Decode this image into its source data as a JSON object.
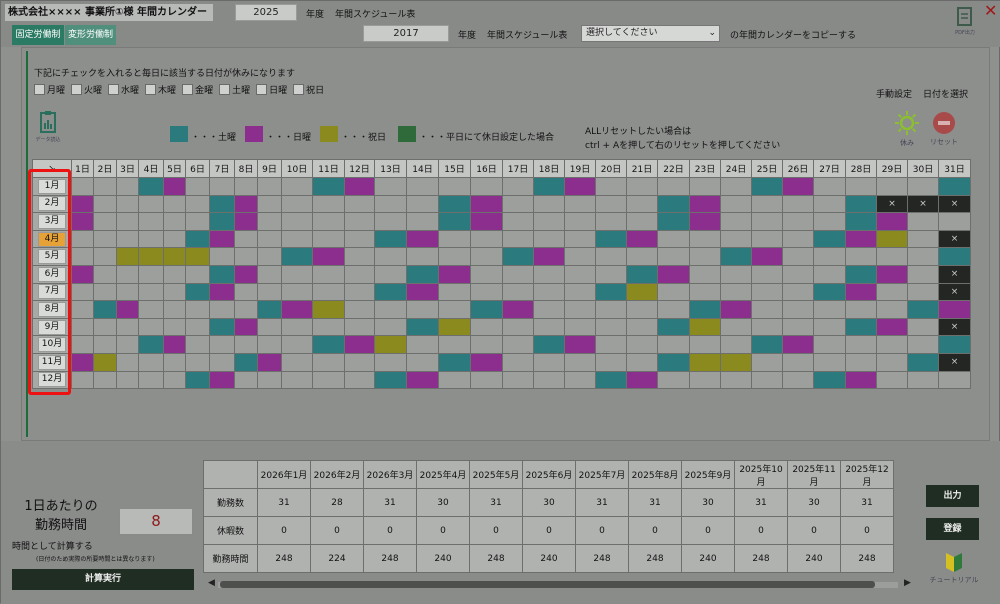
{
  "header": {
    "app_title": "株式会社××××  事業所①様 年間カレンダー",
    "year_top": "2025",
    "year_label": "年度",
    "schedule_label": "年間スケジュール表",
    "year_copy": "2017",
    "copy_select": "選択してください",
    "copy_suffix": "の年間カレンダーをコピーする",
    "tab_fixed": "固定労働制",
    "tab_variable": "変形労働制",
    "pdf_label": "PDF出力"
  },
  "checkbox_note": "下記にチェックを入れると毎日に該当する日付が休みになります",
  "weekdays": [
    "月曜",
    "火曜",
    "水曜",
    "木曜",
    "金曜",
    "土曜",
    "日曜",
    "祝日"
  ],
  "right_links": {
    "manual": "手動設定",
    "date_select": "日付を選択"
  },
  "legend": {
    "data_read": "データ読込",
    "sat": "・・・土曜",
    "sun": "・・・日曜",
    "holiday": "・・・祝日",
    "weekday_off": "・・・平日にて休日設定した場合",
    "colors": {
      "sat": "#2a7a7e",
      "sun": "#8b2e8d",
      "holiday": "#8a8a1e",
      "weekday_off": "#2f6b3a"
    }
  },
  "reset_note": {
    "line1": "ALLリセットしたい場合は",
    "line2": "ctrl + Aを押して右のリセットを押してください"
  },
  "icons": {
    "rest": "休み",
    "reset": "リセット"
  },
  "calendar": {
    "corner": "↘",
    "days": [
      "1日",
      "2日",
      "3日",
      "4日",
      "5日",
      "6日",
      "7日",
      "8日",
      "9日",
      "10日",
      "11日",
      "12日",
      "13日",
      "14日",
      "15日",
      "16日",
      "17日",
      "18日",
      "19日",
      "20日",
      "21日",
      "22日",
      "23日",
      "24日",
      "25日",
      "26日",
      "27日",
      "28日",
      "29日",
      "30日",
      "31日"
    ],
    "months": [
      "1月",
      "2月",
      "3月",
      "4月",
      "5月",
      "6月",
      "7月",
      "8月",
      "9月",
      "10月",
      "11月",
      "12月"
    ],
    "selected_month": 3,
    "rows": [
      [
        0,
        0,
        0,
        1,
        2,
        0,
        0,
        0,
        0,
        0,
        1,
        2,
        0,
        0,
        0,
        0,
        0,
        1,
        2,
        0,
        0,
        0,
        0,
        0,
        1,
        2,
        0,
        0,
        0,
        0,
        1
      ],
      [
        2,
        0,
        0,
        0,
        0,
        0,
        1,
        2,
        0,
        0,
        0,
        0,
        0,
        0,
        1,
        2,
        0,
        0,
        0,
        0,
        0,
        1,
        2,
        0,
        0,
        0,
        0,
        1,
        4,
        4,
        4
      ],
      [
        2,
        0,
        0,
        0,
        0,
        0,
        1,
        2,
        0,
        0,
        0,
        0,
        0,
        0,
        1,
        2,
        0,
        0,
        0,
        0,
        0,
        1,
        2,
        0,
        0,
        0,
        0,
        1,
        2,
        0,
        0
      ],
      [
        0,
        0,
        0,
        0,
        0,
        1,
        2,
        0,
        0,
        0,
        0,
        0,
        1,
        2,
        0,
        0,
        0,
        0,
        0,
        1,
        2,
        0,
        0,
        0,
        0,
        0,
        1,
        2,
        3,
        0,
        4
      ],
      [
        0,
        0,
        3,
        3,
        3,
        3,
        0,
        0,
        0,
        1,
        2,
        0,
        0,
        0,
        0,
        0,
        1,
        2,
        0,
        0,
        0,
        0,
        0,
        1,
        2,
        0,
        0,
        0,
        0,
        0,
        1
      ],
      [
        2,
        0,
        0,
        0,
        0,
        0,
        1,
        2,
        0,
        0,
        0,
        0,
        0,
        1,
        2,
        0,
        0,
        0,
        0,
        0,
        1,
        2,
        0,
        0,
        0,
        0,
        0,
        1,
        2,
        0,
        4
      ],
      [
        0,
        0,
        0,
        0,
        0,
        1,
        2,
        0,
        0,
        0,
        0,
        0,
        1,
        2,
        0,
        0,
        0,
        0,
        0,
        1,
        3,
        0,
        0,
        0,
        0,
        0,
        1,
        2,
        0,
        0,
        4
      ],
      [
        0,
        1,
        2,
        0,
        0,
        0,
        0,
        0,
        1,
        2,
        3,
        0,
        0,
        0,
        0,
        1,
        2,
        0,
        0,
        0,
        0,
        0,
        1,
        2,
        0,
        0,
        0,
        0,
        0,
        1,
        2
      ],
      [
        0,
        0,
        0,
        0,
        0,
        0,
        1,
        2,
        0,
        0,
        0,
        0,
        0,
        1,
        3,
        0,
        0,
        0,
        0,
        0,
        0,
        1,
        3,
        0,
        0,
        0,
        0,
        1,
        2,
        0,
        4
      ],
      [
        0,
        0,
        0,
        1,
        2,
        0,
        0,
        0,
        0,
        0,
        1,
        2,
        3,
        0,
        0,
        0,
        0,
        1,
        2,
        0,
        0,
        0,
        0,
        0,
        1,
        2,
        0,
        0,
        0,
        0,
        1
      ],
      [
        2,
        3,
        0,
        0,
        0,
        0,
        0,
        1,
        2,
        0,
        0,
        0,
        0,
        0,
        1,
        2,
        0,
        0,
        0,
        0,
        0,
        1,
        3,
        3,
        0,
        0,
        0,
        0,
        0,
        1,
        4
      ],
      [
        0,
        0,
        0,
        0,
        0,
        1,
        2,
        0,
        0,
        0,
        0,
        0,
        1,
        2,
        0,
        0,
        0,
        0,
        0,
        1,
        2,
        0,
        0,
        0,
        0,
        0,
        1,
        2,
        0,
        0,
        0
      ]
    ]
  },
  "worktime": {
    "title_line1": "1日あたりの",
    "title_line2": "勤務時間",
    "value": "8",
    "note": "時間として計算する",
    "subnote": "(日付のため実際の所要時間とは異なります)",
    "calc_button": "計算実行"
  },
  "summary": {
    "months": [
      "2026年1月",
      "2026年2月",
      "2026年3月",
      "2025年4月",
      "2025年5月",
      "2025年6月",
      "2025年7月",
      "2025年8月",
      "2025年9月",
      "2025年10月",
      "2025年11月",
      "2025年12月"
    ],
    "rows": [
      {
        "label": "勤務数",
        "values": [
          "31",
          "28",
          "31",
          "30",
          "31",
          "30",
          "31",
          "31",
          "30",
          "31",
          "30",
          "31"
        ]
      },
      {
        "label": "休暇数",
        "values": [
          "0",
          "0",
          "0",
          "0",
          "0",
          "0",
          "0",
          "0",
          "0",
          "0",
          "0",
          "0"
        ]
      },
      {
        "label": "勤務時間",
        "values": [
          "248",
          "224",
          "248",
          "240",
          "248",
          "240",
          "248",
          "248",
          "240",
          "248",
          "240",
          "248"
        ]
      }
    ]
  },
  "buttons": {
    "output": "出力",
    "register": "登録",
    "tutorial": "チュートリアル"
  }
}
